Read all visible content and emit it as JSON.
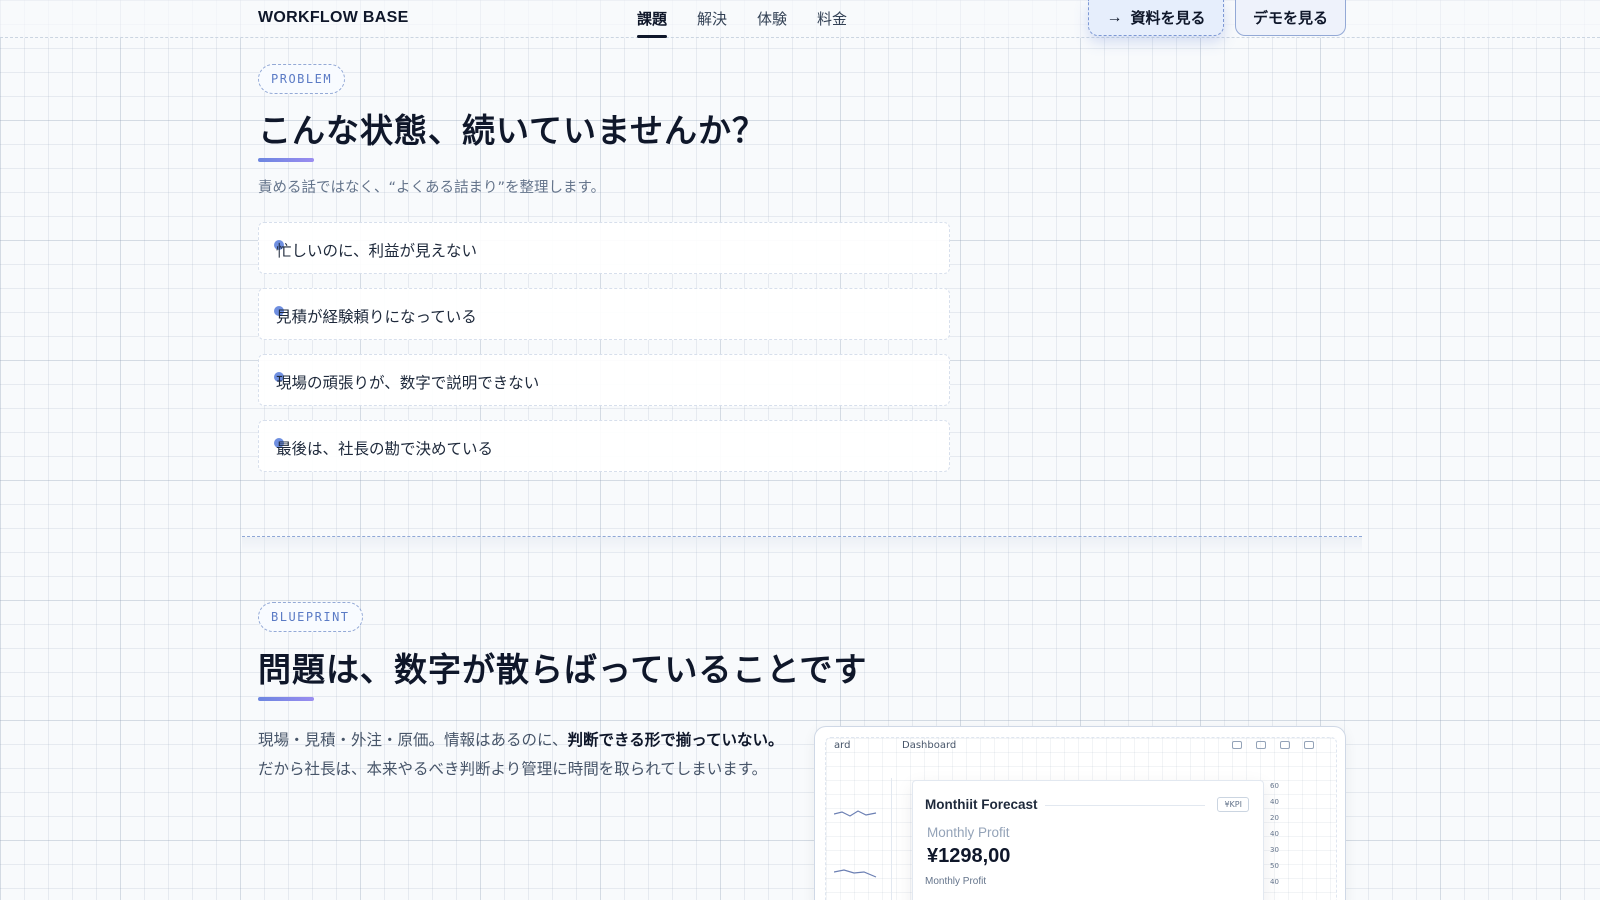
{
  "header": {
    "brand": "WORKFLOW BASE",
    "nav": [
      {
        "label": "課題",
        "active": true
      },
      {
        "label": "解決",
        "active": false
      },
      {
        "label": "体験",
        "active": false
      },
      {
        "label": "料金",
        "active": false
      }
    ],
    "cta_primary": {
      "icon": "arrow-right-icon",
      "label": "資料を見る"
    },
    "cta_secondary": {
      "label": "デモを見る"
    }
  },
  "problem": {
    "tag": "PROBLEM",
    "title": "こんな状態、続いていませんか？",
    "subtitle": "責める話ではなく、“よくある詰まり”を整理します。",
    "items": [
      "忙しいのに、利益が見えない",
      "見積が経験頼りになっている",
      "現場の頑張りが、数字で説明できない",
      "最後は、社長の勘で決めている"
    ]
  },
  "blueprint": {
    "tag": "BLUEPRINT",
    "title": "問題は、数字が散らばっていることです",
    "body_pre": "現場・見積・外注・原価。情報はあるのに、",
    "body_strong": "判断できる形で揃っていない。",
    "body_post": " だから社長は、本来やるべき判断より管理に時間を取られてしまいます。"
  },
  "mockup": {
    "tab_left": "ard",
    "tab_mid": "Dashboard",
    "panel_title": "Monthiit Forecast",
    "kpi_badge": "¥KPI",
    "label": "Monthly Profit",
    "value": "¥1298,00",
    "footer_label": "Monthly Profit",
    "y_ticks": [
      "60",
      "40",
      "20",
      "40",
      "30",
      "50",
      "40"
    ]
  },
  "colors": {
    "accent": "#6c86e0",
    "ink": "#0f172a",
    "muted": "#64748b"
  }
}
